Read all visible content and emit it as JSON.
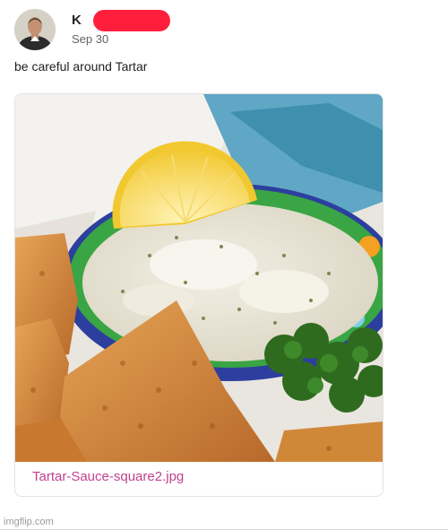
{
  "post": {
    "author_initial": "K",
    "date": "Sep 30",
    "text": "be careful around Tartar"
  },
  "link_card": {
    "title": "Tartar-Sauce-square2.jpg",
    "image_icon": "tartar-sauce-photo"
  },
  "watermark": "imgflip.com",
  "colors": {
    "link": "#c1428f",
    "redaction": "#ff1f3d",
    "date": "#5f6368"
  }
}
